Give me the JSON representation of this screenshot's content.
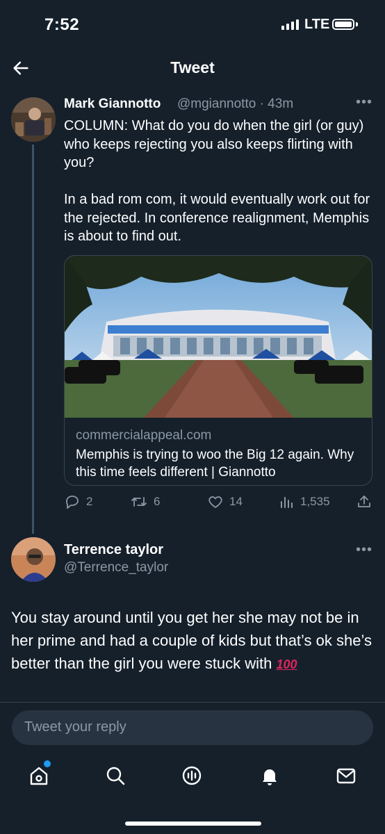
{
  "status": {
    "time": "7:52",
    "network": "LTE"
  },
  "header": {
    "title": "Tweet"
  },
  "tweet": {
    "author": "Mark Giannotto",
    "handle": "@mgiannotto · 43m",
    "text": "COLUMN: What do you do when the girl (or guy) who keeps rejecting you also keeps flirting with you?\n\nIn a bad rom com, it would eventually work out for the rejected. In conference realignment, Memphis is about to find out.",
    "card": {
      "domain": "commercialappeal.com",
      "title": "Memphis is trying to woo the Big 12 again. Why this time feels different | Giannotto"
    },
    "stats": {
      "replies": "2",
      "retweets": "6",
      "likes": "14",
      "views": "1,535"
    }
  },
  "reply": {
    "author": "Terrence taylor",
    "handle": "@Terrence_taylor",
    "text": "You stay around until you get her she may not be in her prime and had a couple of kids but that’s ok she’s better than the girl you were stuck with ",
    "emoji": "100"
  },
  "composer": {
    "placeholder": "Tweet your reply"
  },
  "colors": {
    "background": "#15202b",
    "accent": "#1d9bf0",
    "muted": "#8b98a5"
  }
}
